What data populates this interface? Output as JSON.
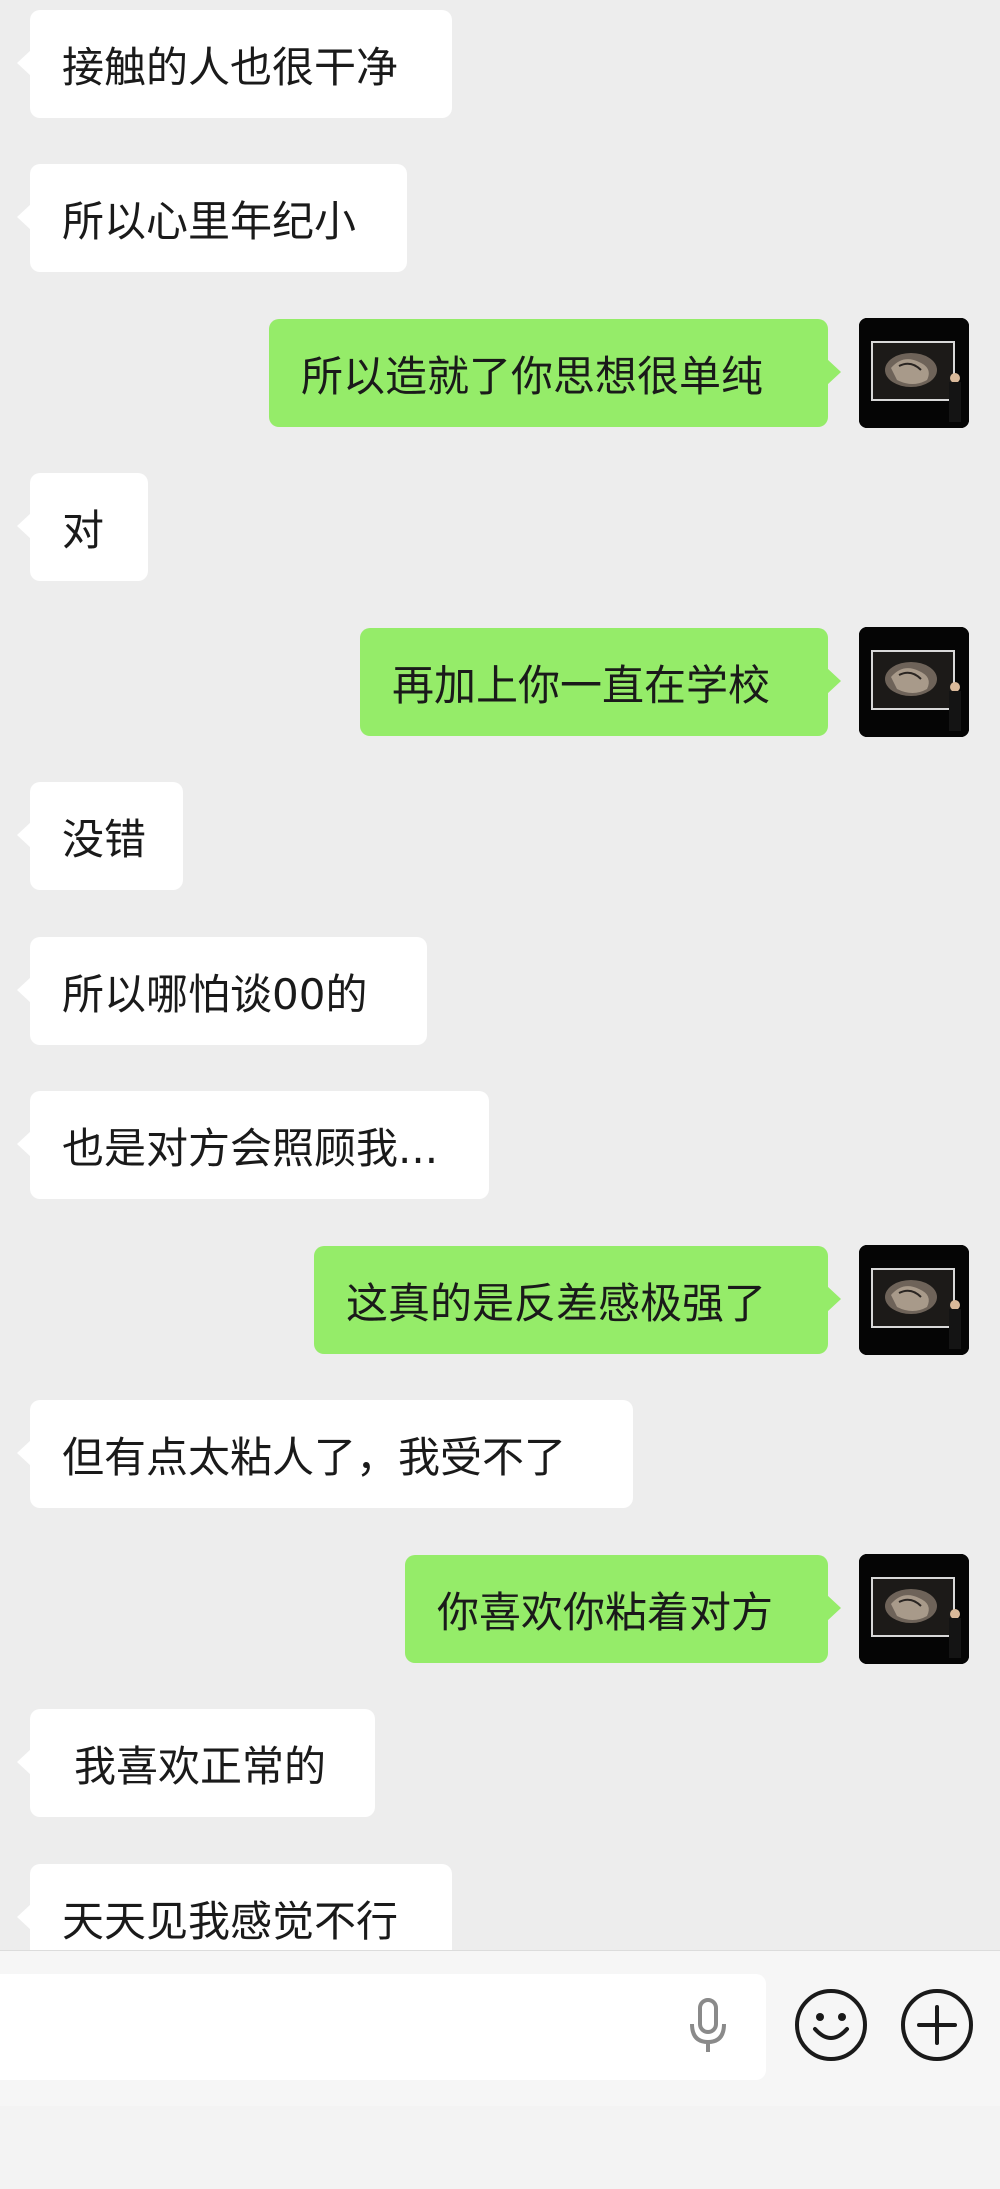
{
  "messages": [
    {
      "side": "left",
      "text": "接触的人也很干净"
    },
    {
      "side": "left",
      "text": "所以心里年纪小"
    },
    {
      "side": "right",
      "text": "所以造就了你思想很单纯"
    },
    {
      "side": "left",
      "text": "对"
    },
    {
      "side": "right",
      "text": "再加上你一直在学校"
    },
    {
      "side": "left",
      "text": "没错"
    },
    {
      "side": "left",
      "text": "所以哪怕谈00的"
    },
    {
      "side": "left",
      "text": "也是对方会照顾我..."
    },
    {
      "side": "right",
      "text": "这真的是反差感极强了"
    },
    {
      "side": "left",
      "text": "但有点太粘人了，我受不了"
    },
    {
      "side": "right",
      "text": "你喜欢你粘着对方"
    },
    {
      "side": "left",
      "text": "我喜欢正常的"
    },
    {
      "side": "left",
      "text": "天天见我感觉不行"
    }
  ],
  "input": {
    "value": "",
    "placeholder": ""
  },
  "icons": {
    "mic": "microphone-icon",
    "emoji": "smiley-icon",
    "plus": "plus-circle-icon"
  },
  "colors": {
    "background": "#ededed",
    "incoming_bubble": "#ffffff",
    "outgoing_bubble": "#95ec69"
  }
}
